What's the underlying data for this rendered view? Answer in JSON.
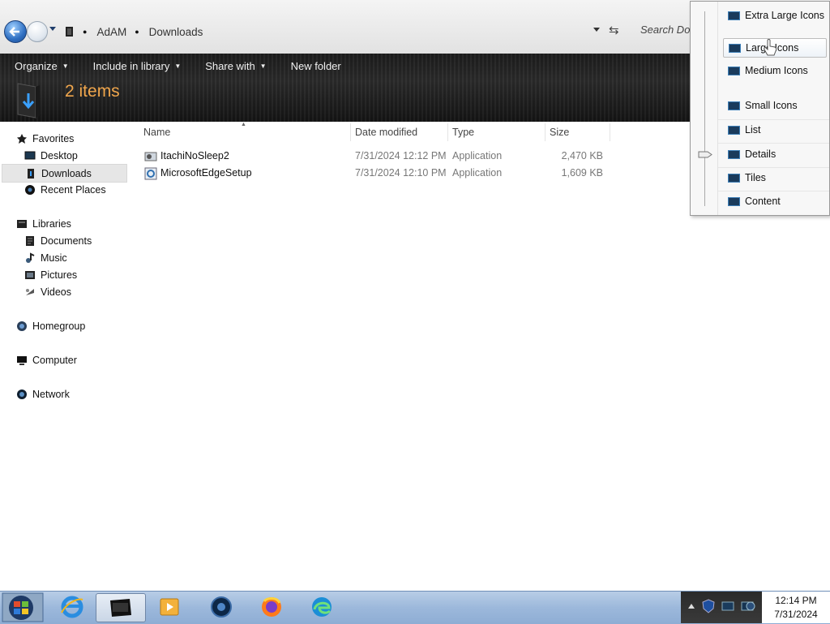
{
  "address": {
    "crumbs": [
      "AdAM",
      "Downloads"
    ],
    "search_placeholder": "Search Dow"
  },
  "toolbar": {
    "organize": "Organize",
    "include_in_library": "Include in library",
    "share_with": "Share with",
    "new_folder": "New folder"
  },
  "header": {
    "items_count": "2 items"
  },
  "nav": {
    "favorites": "Favorites",
    "desktop": "Desktop",
    "downloads": "Downloads",
    "recent_places": "Recent Places",
    "libraries": "Libraries",
    "documents": "Documents",
    "music": "Music",
    "pictures": "Pictures",
    "videos": "Videos",
    "homegroup": "Homegroup",
    "computer": "Computer",
    "network": "Network"
  },
  "columns": {
    "name": "Name",
    "date_modified": "Date modified",
    "type": "Type",
    "size": "Size"
  },
  "files": [
    {
      "name": "ItachiNoSleep2",
      "date": "7/31/2024 12:12 PM",
      "type": "Application",
      "size": "2,470 KB"
    },
    {
      "name": "MicrosoftEdgeSetup",
      "date": "7/31/2024 12:10 PM",
      "type": "Application",
      "size": "1,609 KB"
    }
  ],
  "view_menu": {
    "extra_large_icons": "Extra Large Icons",
    "large_icons": "Large Icons",
    "medium_icons": "Medium Icons",
    "small_icons": "Small Icons",
    "list": "List",
    "details": "Details",
    "tiles": "Tiles",
    "content": "Content",
    "selected": "Details"
  },
  "clock": {
    "time": "12:14 PM",
    "date": "7/31/2024"
  },
  "colors": {
    "items_count": "#f0a64c",
    "toolbar_bg": "#1c1c1c",
    "taskbar": "#9cb8db"
  }
}
